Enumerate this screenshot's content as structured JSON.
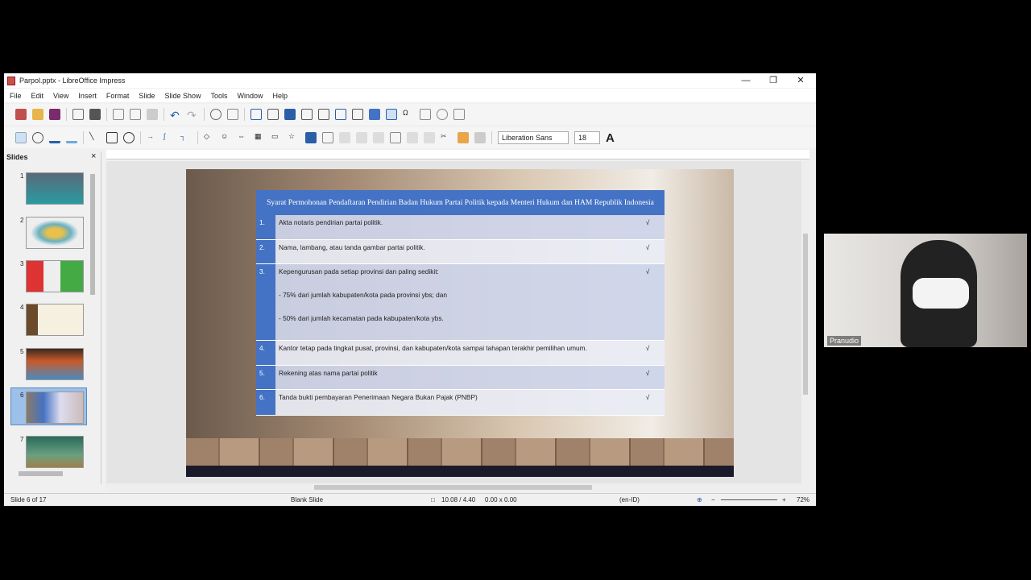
{
  "window": {
    "title": "Parpol.pptx - LibreOffice Impress",
    "minimize": "—",
    "restore": "❐",
    "close": "✕"
  },
  "menu": [
    "File",
    "Edit",
    "View",
    "Insert",
    "Format",
    "Slide",
    "Slide Show",
    "Tools",
    "Window",
    "Help"
  ],
  "toolbar": {
    "font_name": "Liberation Sans",
    "font_size": "18"
  },
  "slides_panel": {
    "title": "Slides",
    "close": "×",
    "numbers": [
      "1",
      "2",
      "3",
      "4",
      "5",
      "6",
      "7"
    ],
    "selected": 6
  },
  "slide": {
    "table_title": "Syarat Permohonan Pendaftaran Pendirian Badan Hukum Partai Politik kepada Menteri Hukum dan HAM Republik Indonesia",
    "rows": [
      {
        "num": "1.",
        "text": "Akta notaris pendirian partai politik.",
        "check": "√"
      },
      {
        "num": "2.",
        "text": "Nama, lambang, atau tanda gambar partai politik.",
        "check": "√"
      },
      {
        "num": "3.",
        "text": "Kepengurusan pada setiap provinsi dan paling sedikit:",
        "sub1": "- 75% dari jumlah kabupaten/kota pada provinsi ybs; dan",
        "sub2": "- 50% dari jumlah kecamatan pada kabupaten/kota ybs.",
        "check": "√"
      },
      {
        "num": "4.",
        "text": "Kantor tetap pada tingkat pusat, provinsi, dan kabupaten/kota sampai tahapan terakhir pemilihan umum.",
        "check": "√"
      },
      {
        "num": "5.",
        "text": "Rekening atas nama partai politik",
        "check": "√"
      },
      {
        "num": "6.",
        "text": "Tanda bukti pembayaran Penerimaan Negara Bukan Pajak (PNBP)",
        "check": "√"
      }
    ]
  },
  "status": {
    "slide": "Slide 6 of 17",
    "layout": "Blank Slide",
    "position": "10.08 / 4.40",
    "size": "0.00 x 0.00",
    "language": "(en-ID)",
    "zoom": "72%"
  },
  "webcam": {
    "name": "Pranudio"
  },
  "colors": {
    "table_header": "#4472c4"
  }
}
